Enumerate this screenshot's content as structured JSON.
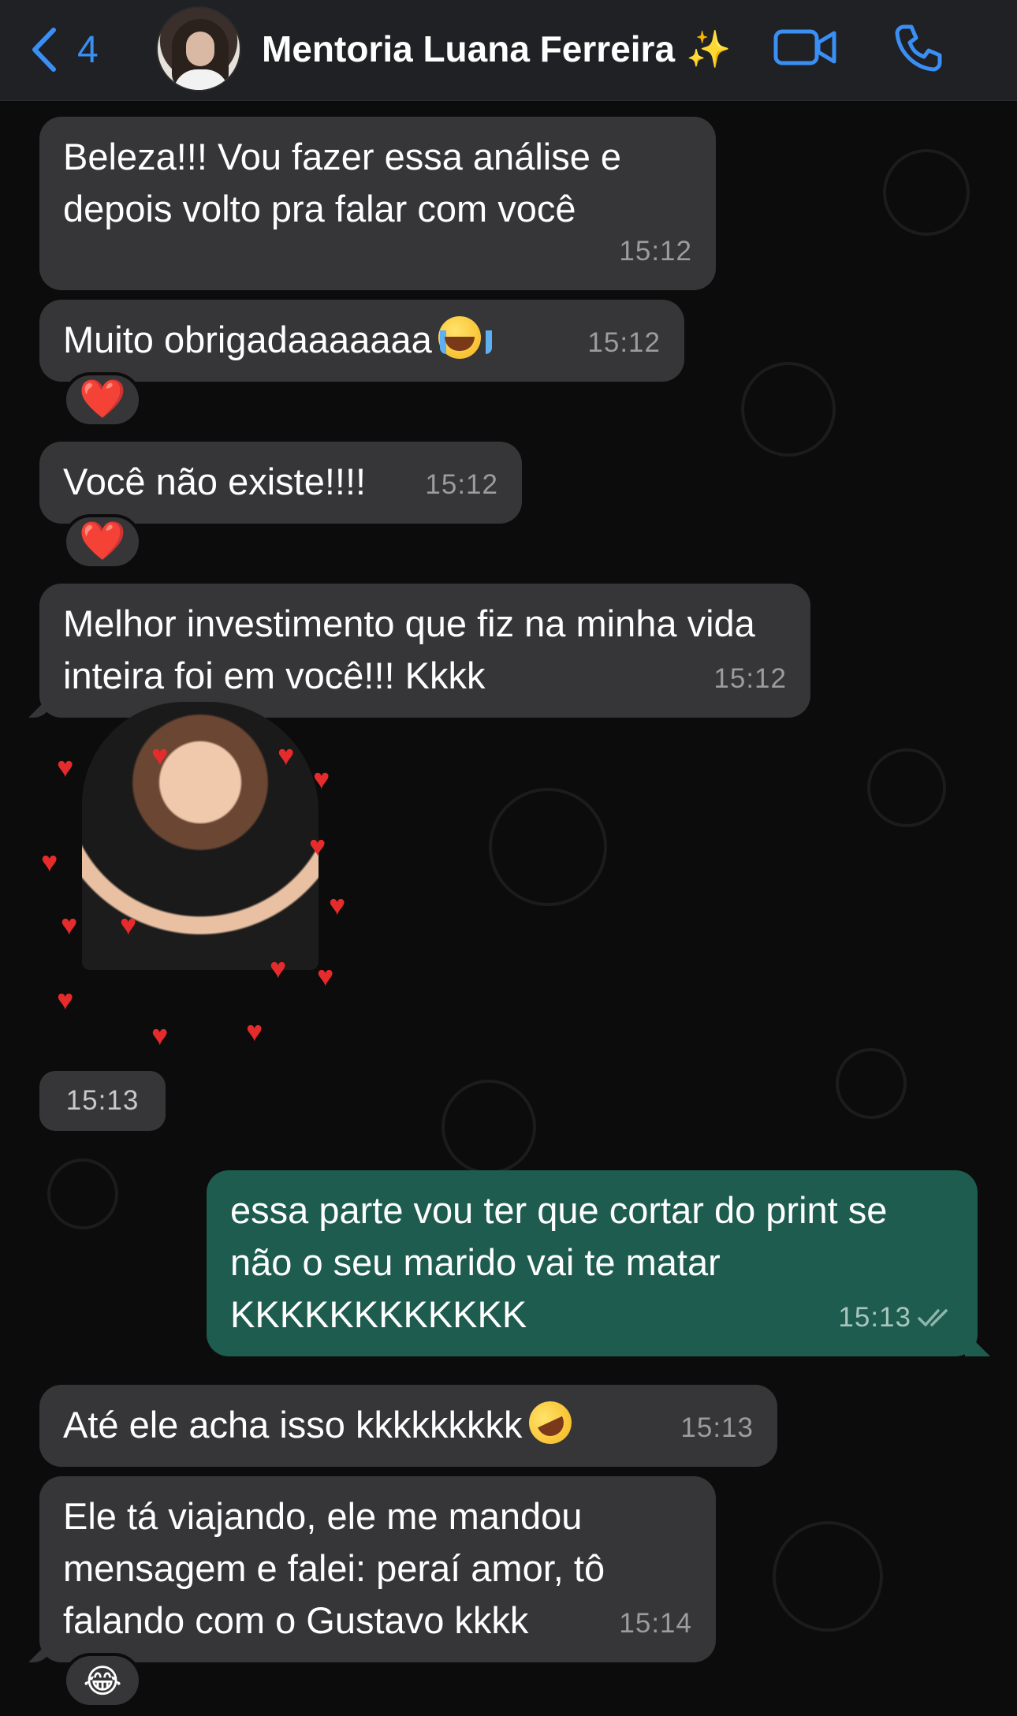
{
  "header": {
    "back_count": "4",
    "contact_name": "Mentoria Luana Ferreira",
    "name_emoji": "✨"
  },
  "colors": {
    "accent": "#3a8ff5",
    "incoming_bubble": "#363638",
    "outgoing_bubble": "#1d5c4f",
    "background": "#0c0c0c"
  },
  "messages": [
    {
      "text": "Beleza!!! Vou fazer essa análise e depois volto pra falar com você",
      "time": "15:12"
    },
    {
      "text": "Muito obrigadaaaaaaa",
      "time": "15:12",
      "emoji": "loudly-crying-face",
      "reaction": "❤️"
    },
    {
      "text": "Você não existe!!!!",
      "time": "15:12",
      "reaction": "❤️"
    },
    {
      "text": "Melhor investimento que fiz na minha vida inteira foi em você!!! Kkkk",
      "time": "15:12"
    },
    {
      "sticker": "child-with-hearts-sticker",
      "time": "15:13"
    },
    {
      "text": "essa parte vou ter que cortar do print se não o seu marido vai te matar KKKKKKKKKKKK",
      "time": "15:13",
      "outgoing": true,
      "status": "read"
    },
    {
      "text": "Até ele acha isso kkkkkkkkk",
      "time": "15:13",
      "emoji": "rolling-on-floor-laughing"
    },
    {
      "text": "Ele tá viajando, ele me mandou mensagem e falei: peraí amor, tô falando com o Gustavo kkkk",
      "time": "15:14",
      "reaction": "😂"
    }
  ]
}
